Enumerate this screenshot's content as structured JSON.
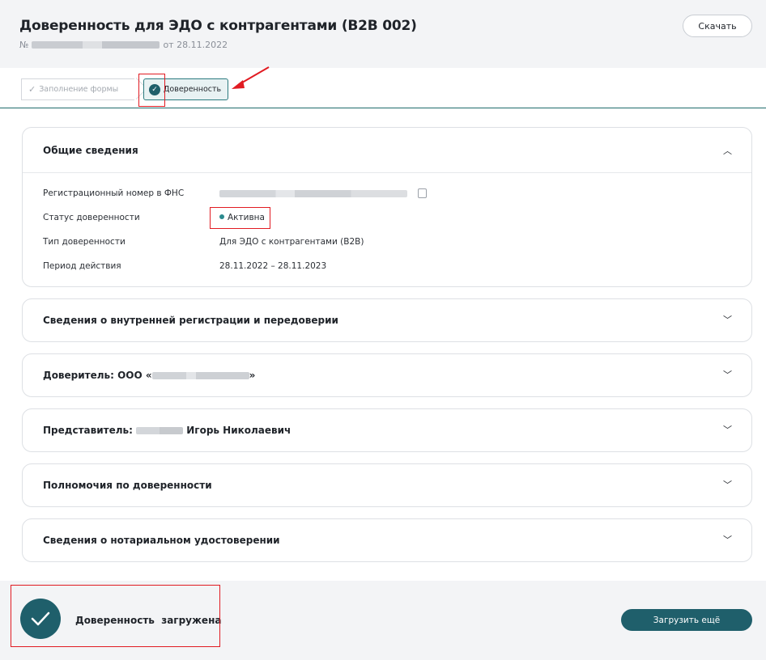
{
  "header": {
    "title": "Доверенность для ЭДО с контрагентами (B2B 002)",
    "number_prefix": "№",
    "date_text": "от 28.11.2022",
    "download_label": "Скачать"
  },
  "stepper": {
    "step1_label": "Заполнение формы",
    "step2_label": "Доверенность"
  },
  "general": {
    "title": "Общие сведения",
    "reg_label": "Регистрационный номер в ФНС",
    "status_label": "Статус доверенности",
    "status_value": "Активна",
    "type_label": "Тип доверенности",
    "type_value": "Для ЭДО с контрагентами (B2B)",
    "period_label": "Период действия",
    "period_value": "28.11.2022 – 28.11.2023"
  },
  "sections": [
    {
      "title": "Сведения о внутренней регистрации и передоверии"
    },
    {
      "title_prefix": "Доверитель: ООО «",
      "title_suffix": "»"
    },
    {
      "title_prefix": "Представитель: ",
      "title_suffix": " Игорь Николаевич"
    },
    {
      "title": "Полномочия по доверенности"
    },
    {
      "title": "Сведения о нотариальном удостоверении"
    }
  ],
  "footer": {
    "loaded_text": "Доверенность  загружена",
    "upload_more_label": "Загрузить ещё"
  },
  "colors": {
    "accent": "#1f5f6b",
    "highlight": "#e11b22",
    "status": "#2b8a8e"
  }
}
